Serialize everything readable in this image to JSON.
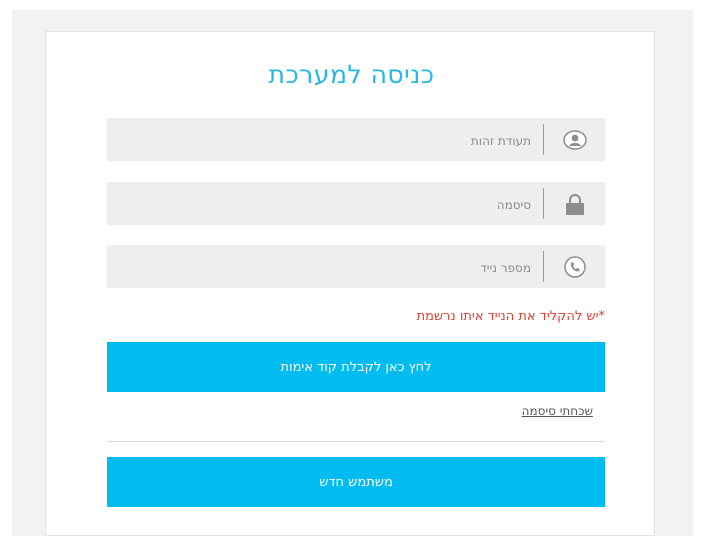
{
  "login": {
    "title": "כניסה למערכת",
    "fields": [
      {
        "placeholder": "תעודת זהות",
        "icon": "user-icon"
      },
      {
        "placeholder": "סיסמה",
        "icon": "lock-icon"
      },
      {
        "placeholder": "מספר נייד",
        "icon": "phone-icon"
      }
    ],
    "note": "*יש להקליד את הנייד איתו נרשמת",
    "send_code_label": "לחץ כאן לקבלת קוד אימות",
    "forgot_password_label": "שכחתי סיסמה",
    "new_user_label": "משתמש חדש"
  },
  "colors": {
    "accent": "#00bcf0",
    "title": "#25b7e6",
    "note": "#e4403a",
    "field_bg": "#eeeeee"
  }
}
